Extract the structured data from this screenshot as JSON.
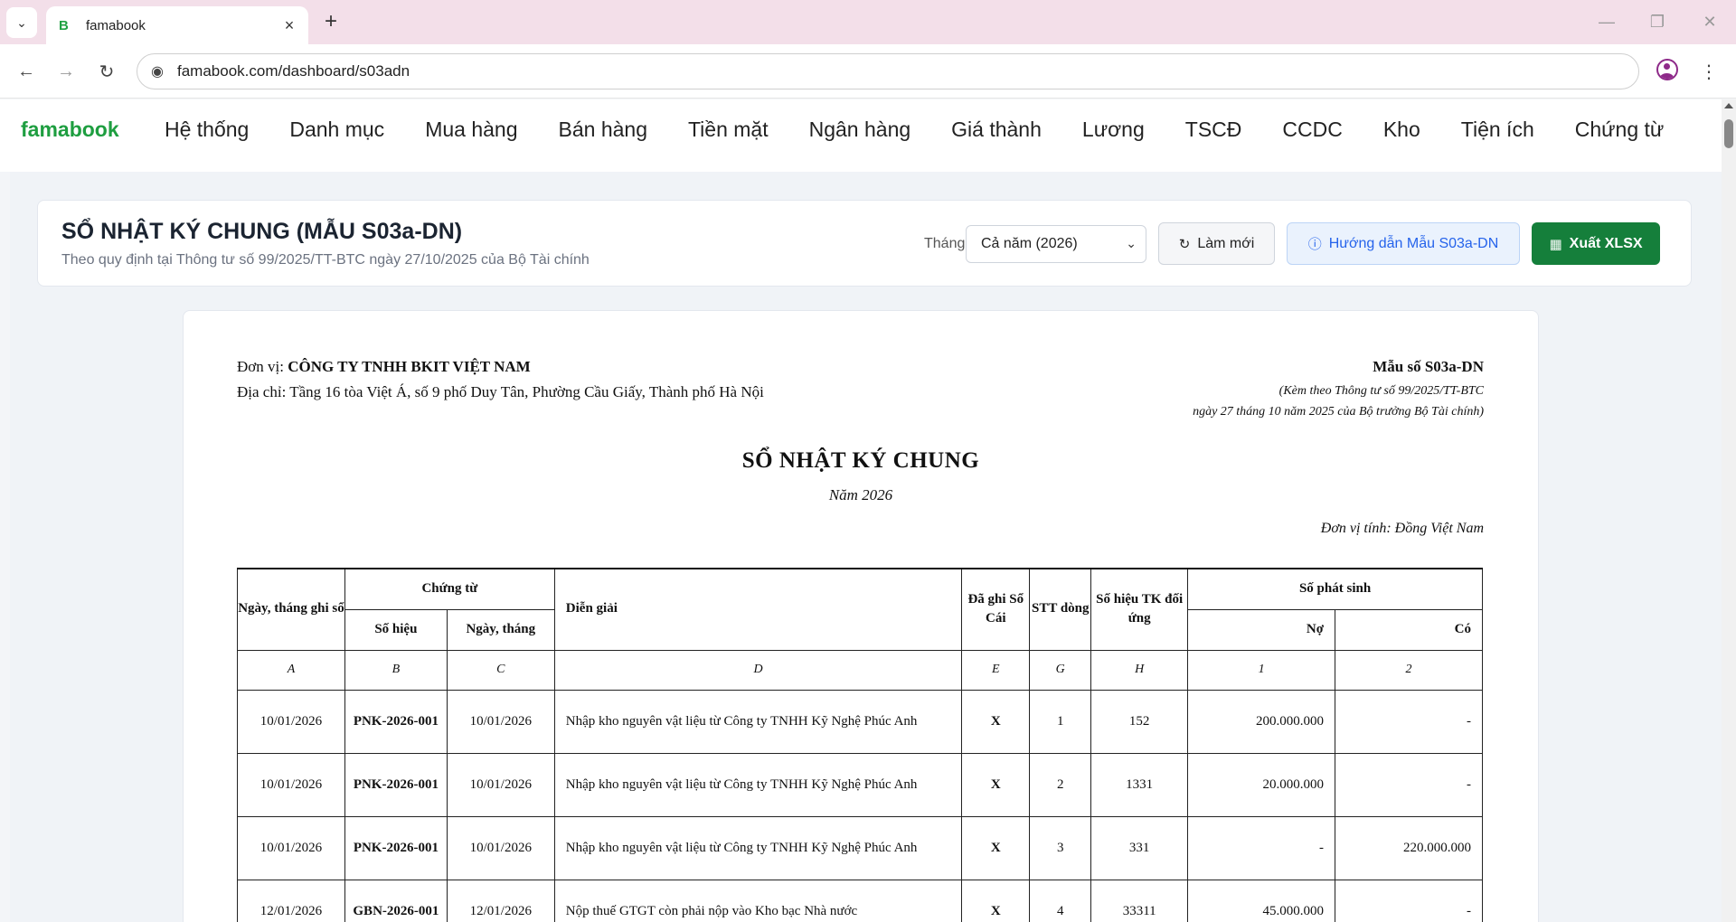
{
  "browser": {
    "tab_title": "famabook",
    "tab_favicon": "B",
    "url": "famabook.com/dashboard/s03adn"
  },
  "app": {
    "brand": "famabook",
    "menu": [
      "Hệ thống",
      "Danh mục",
      "Mua hàng",
      "Bán hàng",
      "Tiền mặt",
      "Ngân hàng",
      "Giá thành",
      "Lương",
      "TSCĐ",
      "CCDC",
      "Kho",
      "Tiện ích",
      "Chứng từ"
    ]
  },
  "header": {
    "title": "SỔ NHẬT KÝ CHUNG (MẪU S03a-DN)",
    "subtitle": "Theo quy định tại Thông tư số 99/2025/TT-BTC ngày 27/10/2025 của Bộ Tài chính",
    "month_label": "Tháng:",
    "month_value": "Cả năm (2026)",
    "refresh_label": "Làm mới",
    "guide_label": "Hướng dẫn Mẫu S03a-DN",
    "export_label": "Xuất XLSX"
  },
  "document": {
    "unit_prefix": "Đơn vị: ",
    "unit_name": "CÔNG TY TNHH BKIT VIỆT NAM",
    "address": "Địa chỉ: Tầng 16 tòa Việt Á, số 9 phố Duy Tân, Phường Cầu Giấy, Thành phố Hà Nội",
    "form_code": "Mẫu số S03a-DN",
    "form_note_1": "(Kèm theo Thông tư số 99/2025/TT-BTC",
    "form_note_2": "ngày 27 tháng 10 năm 2025 của Bộ trưởng Bộ Tài chính)",
    "title": "SỔ NHẬT KÝ CHUNG",
    "year": "Năm 2026",
    "currency": "Đơn vị tính: Đồng Việt Nam"
  },
  "table": {
    "headers": {
      "date_recorded": "Ngày, tháng ghi sổ",
      "voucher": "Chứng từ",
      "voucher_no": "Số hiệu",
      "voucher_date": "Ngày, tháng",
      "description": "Diễn giải",
      "posted": "Đã ghi Sổ Cái",
      "line_no": "STT dòng",
      "account": "Số hiệu TK đối ứng",
      "amount": "Số phát sinh",
      "debit": "Nợ",
      "credit": "Có"
    },
    "codes": [
      "A",
      "B",
      "C",
      "D",
      "E",
      "G",
      "H",
      "1",
      "2"
    ],
    "rows": [
      {
        "date": "10/01/2026",
        "voucher_no": "PNK-2026-001",
        "voucher_date": "10/01/2026",
        "description": "Nhập kho nguyên vật liệu từ Công ty TNHH Kỹ Nghệ Phúc Anh",
        "posted": "X",
        "line": "1",
        "account": "152",
        "debit": "200.000.000",
        "credit": "-"
      },
      {
        "date": "10/01/2026",
        "voucher_no": "PNK-2026-001",
        "voucher_date": "10/01/2026",
        "description": "Nhập kho nguyên vật liệu từ Công ty TNHH Kỹ Nghệ Phúc Anh",
        "posted": "X",
        "line": "2",
        "account": "1331",
        "debit": "20.000.000",
        "credit": "-"
      },
      {
        "date": "10/01/2026",
        "voucher_no": "PNK-2026-001",
        "voucher_date": "10/01/2026",
        "description": "Nhập kho nguyên vật liệu từ Công ty TNHH Kỹ Nghệ Phúc Anh",
        "posted": "X",
        "line": "3",
        "account": "331",
        "debit": "-",
        "credit": "220.000.000"
      },
      {
        "date": "12/01/2026",
        "voucher_no": "GBN-2026-001",
        "voucher_date": "12/01/2026",
        "description": "Nộp thuế GTGT còn phải nộp vào Kho bạc Nhà nước",
        "posted": "X",
        "line": "4",
        "account": "33311",
        "debit": "45.000.000",
        "credit": "-"
      }
    ]
  }
}
